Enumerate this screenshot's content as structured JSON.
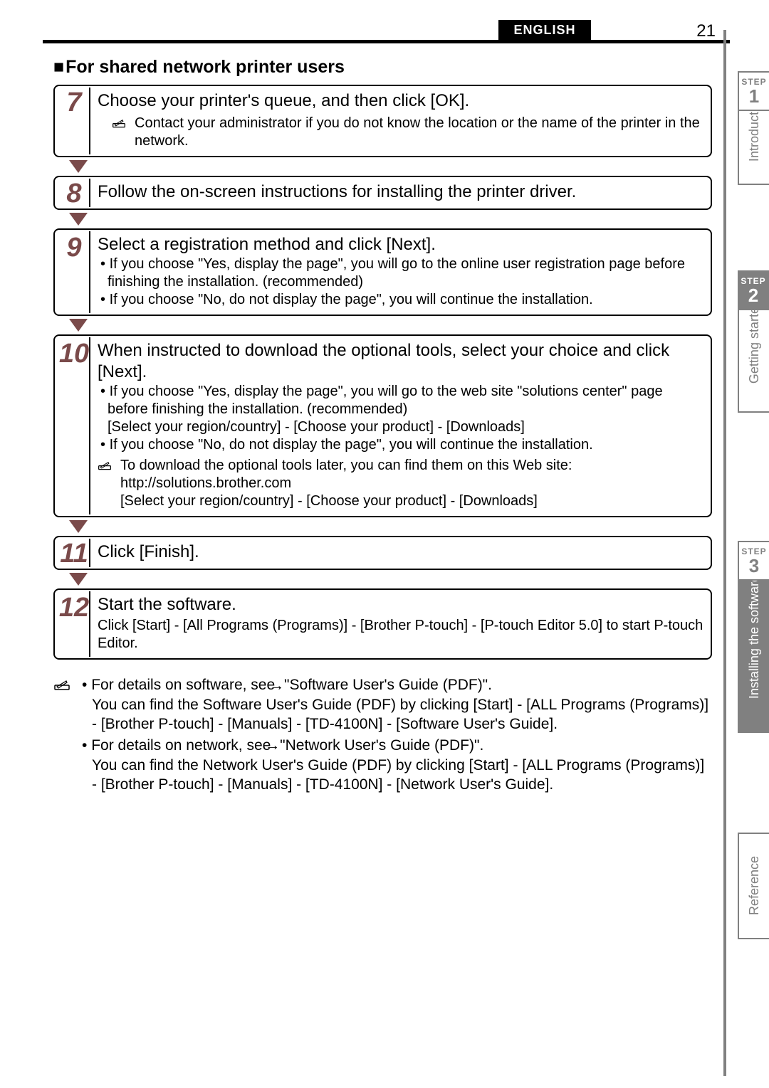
{
  "header": {
    "language": "ENGLISH",
    "page_number": "21"
  },
  "section_title": "For shared network printer users",
  "steps": [
    {
      "num": "7",
      "main": "Choose your printer's queue, and then click [OK].",
      "note": "Contact your administrator if you do not know the location or the name of the printer in the network."
    },
    {
      "num": "8",
      "main": "Follow the on-screen instructions for installing the printer driver."
    },
    {
      "num": "9",
      "main": "Select a registration method and click [Next].",
      "bullets": [
        "If you choose \"Yes, display the page\", you will go to the online user registration page before finishing the installation. (recommended)",
        "If you choose \"No, do not display the page\", you will continue the installation."
      ]
    },
    {
      "num": "10",
      "main": "When instructed to download the optional tools, select your choice and click [Next].",
      "bullets": [
        "If you choose \"Yes, display the page\", you will go to the web site \"solutions center\" page before finishing the installation. (recommended)\n[Select your region/country] - [Choose your product] - [Downloads]",
        "If you choose \"No, do not display the page\", you will continue the installation."
      ],
      "note": "To download the optional tools later, you can find them on this Web site: http://solutions.brother.com\n[Select your region/country] - [Choose your product] - [Downloads]"
    },
    {
      "num": "11",
      "main": "Click [Finish]."
    },
    {
      "num": "12",
      "main": "Start the software.",
      "sub": "Click [Start] - [All Programs (Programs)] - [Brother P-touch] - [P-touch Editor 5.0] to start P-touch Editor."
    }
  ],
  "footer_notes": [
    {
      "lead": "For details on software, see ",
      "arrow_ref": "\"Software User's Guide (PDF)\".",
      "detail": "You can find the Software User's Guide (PDF) by clicking [Start] - [ALL Programs (Programs)] - [Brother P-touch] - [Manuals] - [TD-4100N] - [Software User's Guide]."
    },
    {
      "lead": "For details on network, see ",
      "arrow_ref": "\"Network User's Guide (PDF)\".",
      "detail": "You can find the Network User's Guide (PDF) by clicking [Start] - [ALL Programs (Programs)] - [Brother P-touch] - [Manuals] - [TD-4100N] - [Network User's Guide]."
    }
  ],
  "side_tabs": {
    "intro": "Introduction",
    "step_label": "STEP",
    "step1": "1",
    "getting_started": "Getting started",
    "step2": "2",
    "installing": "Installing the software",
    "step3": "3",
    "reference": "Reference"
  }
}
